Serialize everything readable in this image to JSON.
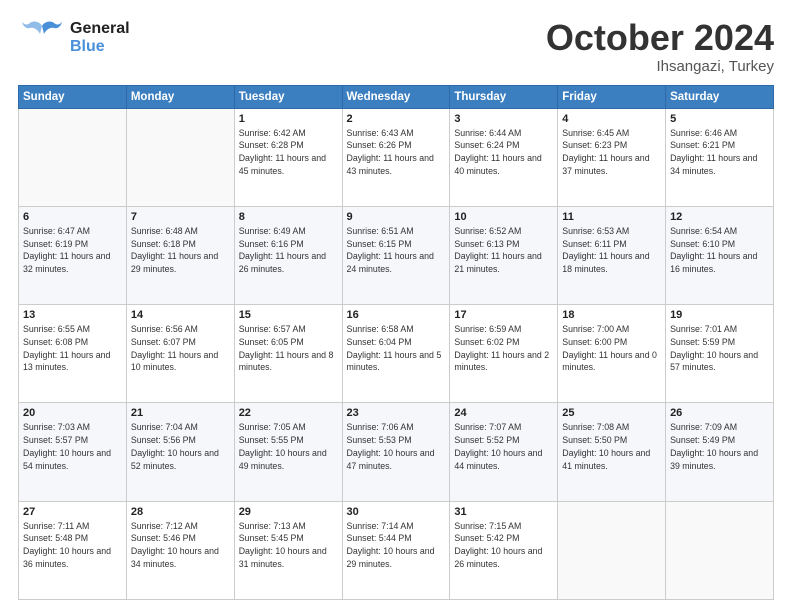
{
  "header": {
    "logo_general": "General",
    "logo_blue": "Blue",
    "title": "October 2024",
    "subtitle": "Ihsangazi, Turkey"
  },
  "weekdays": [
    "Sunday",
    "Monday",
    "Tuesday",
    "Wednesday",
    "Thursday",
    "Friday",
    "Saturday"
  ],
  "weeks": [
    [
      {
        "day": "",
        "sunrise": "",
        "sunset": "",
        "daylight": ""
      },
      {
        "day": "",
        "sunrise": "",
        "sunset": "",
        "daylight": ""
      },
      {
        "day": "1",
        "sunrise": "Sunrise: 6:42 AM",
        "sunset": "Sunset: 6:28 PM",
        "daylight": "Daylight: 11 hours and 45 minutes."
      },
      {
        "day": "2",
        "sunrise": "Sunrise: 6:43 AM",
        "sunset": "Sunset: 6:26 PM",
        "daylight": "Daylight: 11 hours and 43 minutes."
      },
      {
        "day": "3",
        "sunrise": "Sunrise: 6:44 AM",
        "sunset": "Sunset: 6:24 PM",
        "daylight": "Daylight: 11 hours and 40 minutes."
      },
      {
        "day": "4",
        "sunrise": "Sunrise: 6:45 AM",
        "sunset": "Sunset: 6:23 PM",
        "daylight": "Daylight: 11 hours and 37 minutes."
      },
      {
        "day": "5",
        "sunrise": "Sunrise: 6:46 AM",
        "sunset": "Sunset: 6:21 PM",
        "daylight": "Daylight: 11 hours and 34 minutes."
      }
    ],
    [
      {
        "day": "6",
        "sunrise": "Sunrise: 6:47 AM",
        "sunset": "Sunset: 6:19 PM",
        "daylight": "Daylight: 11 hours and 32 minutes."
      },
      {
        "day": "7",
        "sunrise": "Sunrise: 6:48 AM",
        "sunset": "Sunset: 6:18 PM",
        "daylight": "Daylight: 11 hours and 29 minutes."
      },
      {
        "day": "8",
        "sunrise": "Sunrise: 6:49 AM",
        "sunset": "Sunset: 6:16 PM",
        "daylight": "Daylight: 11 hours and 26 minutes."
      },
      {
        "day": "9",
        "sunrise": "Sunrise: 6:51 AM",
        "sunset": "Sunset: 6:15 PM",
        "daylight": "Daylight: 11 hours and 24 minutes."
      },
      {
        "day": "10",
        "sunrise": "Sunrise: 6:52 AM",
        "sunset": "Sunset: 6:13 PM",
        "daylight": "Daylight: 11 hours and 21 minutes."
      },
      {
        "day": "11",
        "sunrise": "Sunrise: 6:53 AM",
        "sunset": "Sunset: 6:11 PM",
        "daylight": "Daylight: 11 hours and 18 minutes."
      },
      {
        "day": "12",
        "sunrise": "Sunrise: 6:54 AM",
        "sunset": "Sunset: 6:10 PM",
        "daylight": "Daylight: 11 hours and 16 minutes."
      }
    ],
    [
      {
        "day": "13",
        "sunrise": "Sunrise: 6:55 AM",
        "sunset": "Sunset: 6:08 PM",
        "daylight": "Daylight: 11 hours and 13 minutes."
      },
      {
        "day": "14",
        "sunrise": "Sunrise: 6:56 AM",
        "sunset": "Sunset: 6:07 PM",
        "daylight": "Daylight: 11 hours and 10 minutes."
      },
      {
        "day": "15",
        "sunrise": "Sunrise: 6:57 AM",
        "sunset": "Sunset: 6:05 PM",
        "daylight": "Daylight: 11 hours and 8 minutes."
      },
      {
        "day": "16",
        "sunrise": "Sunrise: 6:58 AM",
        "sunset": "Sunset: 6:04 PM",
        "daylight": "Daylight: 11 hours and 5 minutes."
      },
      {
        "day": "17",
        "sunrise": "Sunrise: 6:59 AM",
        "sunset": "Sunset: 6:02 PM",
        "daylight": "Daylight: 11 hours and 2 minutes."
      },
      {
        "day": "18",
        "sunrise": "Sunrise: 7:00 AM",
        "sunset": "Sunset: 6:00 PM",
        "daylight": "Daylight: 11 hours and 0 minutes."
      },
      {
        "day": "19",
        "sunrise": "Sunrise: 7:01 AM",
        "sunset": "Sunset: 5:59 PM",
        "daylight": "Daylight: 10 hours and 57 minutes."
      }
    ],
    [
      {
        "day": "20",
        "sunrise": "Sunrise: 7:03 AM",
        "sunset": "Sunset: 5:57 PM",
        "daylight": "Daylight: 10 hours and 54 minutes."
      },
      {
        "day": "21",
        "sunrise": "Sunrise: 7:04 AM",
        "sunset": "Sunset: 5:56 PM",
        "daylight": "Daylight: 10 hours and 52 minutes."
      },
      {
        "day": "22",
        "sunrise": "Sunrise: 7:05 AM",
        "sunset": "Sunset: 5:55 PM",
        "daylight": "Daylight: 10 hours and 49 minutes."
      },
      {
        "day": "23",
        "sunrise": "Sunrise: 7:06 AM",
        "sunset": "Sunset: 5:53 PM",
        "daylight": "Daylight: 10 hours and 47 minutes."
      },
      {
        "day": "24",
        "sunrise": "Sunrise: 7:07 AM",
        "sunset": "Sunset: 5:52 PM",
        "daylight": "Daylight: 10 hours and 44 minutes."
      },
      {
        "day": "25",
        "sunrise": "Sunrise: 7:08 AM",
        "sunset": "Sunset: 5:50 PM",
        "daylight": "Daylight: 10 hours and 41 minutes."
      },
      {
        "day": "26",
        "sunrise": "Sunrise: 7:09 AM",
        "sunset": "Sunset: 5:49 PM",
        "daylight": "Daylight: 10 hours and 39 minutes."
      }
    ],
    [
      {
        "day": "27",
        "sunrise": "Sunrise: 7:11 AM",
        "sunset": "Sunset: 5:48 PM",
        "daylight": "Daylight: 10 hours and 36 minutes."
      },
      {
        "day": "28",
        "sunrise": "Sunrise: 7:12 AM",
        "sunset": "Sunset: 5:46 PM",
        "daylight": "Daylight: 10 hours and 34 minutes."
      },
      {
        "day": "29",
        "sunrise": "Sunrise: 7:13 AM",
        "sunset": "Sunset: 5:45 PM",
        "daylight": "Daylight: 10 hours and 31 minutes."
      },
      {
        "day": "30",
        "sunrise": "Sunrise: 7:14 AM",
        "sunset": "Sunset: 5:44 PM",
        "daylight": "Daylight: 10 hours and 29 minutes."
      },
      {
        "day": "31",
        "sunrise": "Sunrise: 7:15 AM",
        "sunset": "Sunset: 5:42 PM",
        "daylight": "Daylight: 10 hours and 26 minutes."
      },
      {
        "day": "",
        "sunrise": "",
        "sunset": "",
        "daylight": ""
      },
      {
        "day": "",
        "sunrise": "",
        "sunset": "",
        "daylight": ""
      }
    ]
  ]
}
